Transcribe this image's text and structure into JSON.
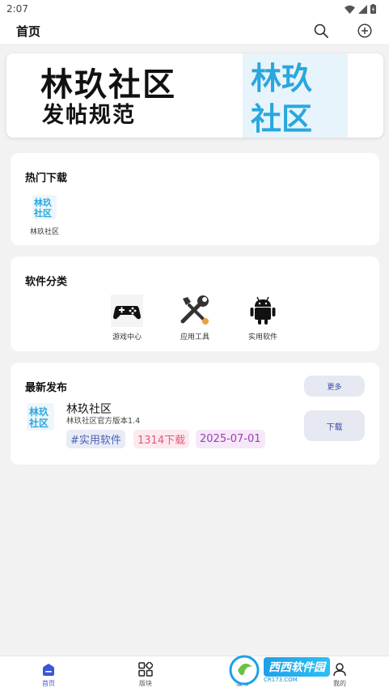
{
  "status_bar": {
    "time": "2:07"
  },
  "app_bar": {
    "title": "首页"
  },
  "banner": {
    "line1": "林玖社区",
    "line2": "发帖规范",
    "logo_text": [
      "林玖",
      "社区"
    ]
  },
  "hot_downloads": {
    "title": "热门下载",
    "items": [
      {
        "label": "林玖社区"
      }
    ]
  },
  "categories": {
    "title": "软件分类",
    "items": [
      {
        "label": "游戏中心",
        "icon": "gamepad-icon"
      },
      {
        "label": "应用工具",
        "icon": "tools-icon"
      },
      {
        "label": "实用软件",
        "icon": "android-icon"
      }
    ]
  },
  "latest": {
    "title": "最新发布",
    "more_label": "更多",
    "item": {
      "name": "林玖社区",
      "desc": "林玖社区官方版本1.4",
      "tag_category": "#实用软件",
      "tag_downloads": "1314下载",
      "tag_date": "2025-07-01",
      "download_label": "下载"
    }
  },
  "bottom_nav": {
    "items": [
      {
        "label": "首页",
        "active": true
      },
      {
        "label": "版块",
        "active": false
      },
      {
        "label": "发布",
        "active": false
      },
      {
        "label": "我的",
        "active": false
      }
    ]
  },
  "watermark": {
    "text": "西西软件园",
    "sub": "CR173.COM"
  },
  "colors": {
    "accent": "#3a57d6",
    "tag_blue": "#4a62b6",
    "tag_pink": "#e35a7a",
    "tag_purple": "#9a3fb0",
    "logo_blue": "#29a7de"
  }
}
